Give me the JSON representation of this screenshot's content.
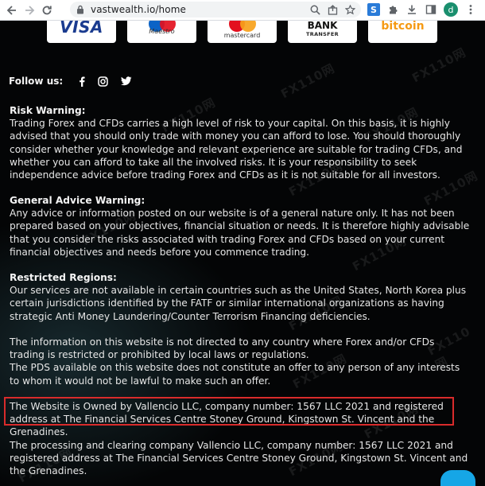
{
  "browser": {
    "url": "vastwealth.io/home",
    "profile_initial": "d",
    "extension_label": "S"
  },
  "payments": {
    "visa": "VISA",
    "maestro": "Maestro",
    "mastercard": "mastercard",
    "bank": "BANK",
    "bank_sub": "TRANSFER",
    "bitcoin": "bitcoin"
  },
  "follow": {
    "label": "Follow us:",
    "facebook": "f",
    "instagram": "◎",
    "twitter": "🐦"
  },
  "sections": {
    "risk_heading": "Risk Warning:",
    "risk_body": "Trading Forex and CFDs carries a high level of risk to your capital. On this basis, it is highly advised that you should only trade with money you can afford to lose. You should thoroughly consider whether your knowledge and relevant experience are suitable for trading CFDs, and whether you can afford to take all the involved risks. It is your responsibility to seek independence advice before trading Forex and CFDs as it is not suitable for all investors.",
    "advice_heading": "General Advice Warning:",
    "advice_body": "Any advice or information posted on our website is of a general nature only. It has not been prepared based on your objectives, financial situation or needs. It is therefore highly advisable that you consider the risks associated with trading Forex and CFDs based on your current financial objectives and needs before you commence trading.",
    "regions_heading": "Restricted Regions:",
    "regions_body": "Our services are not available in certain countries such as the United States, North Korea  plus certain jurisdictions identified by the FATF or similar international organizations as having strategic Anti Money Laundering/Counter Terrorism Financing deficiencies.",
    "info_body_1": "The information on this website is not directed to any country where Forex and/or CFDs trading is restricted or prohibited by local laws or regulations.",
    "info_body_2": "The PDS available on this website does not constitute an offer to any person of any interests to whom it would not be lawful to make such an offer.",
    "owner_body": "The Website is Owned by Vallencio LLC, company number: 1567 LLC 2021  and registered address at The Financial Services Centre Stoney Ground, Kingstown St. Vincent and the Grenadines.",
    "processing_body": "The processing and clearing company Vallencio LLC, company number: 1567 LLC 2021 and registered address at The Financial Services Centre Stoney Ground, Kingstown St. Vincent and the Grenadines."
  },
  "colors": {
    "highlight": "#d92b2b",
    "background": "#040506",
    "text": "#e6e6e6"
  }
}
